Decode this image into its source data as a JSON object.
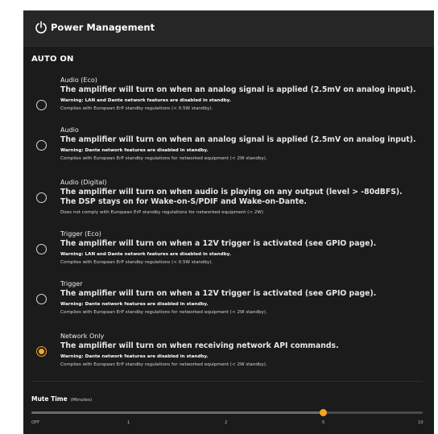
{
  "header": {
    "title": "Power Management",
    "icon": "power-icon"
  },
  "section": {
    "label": "AUTO ON"
  },
  "accent_color": "#f5a623",
  "options": [
    {
      "title": "Audio (Eco)",
      "description": "The amplifier will turn on when an analog signal is applied (2.5mV on analog input).",
      "description2": "",
      "warning": "Warning: LAN and Dante network features are disabled in standby.",
      "note": "Complies with European ErP standby regulations (< 0.5W standby).",
      "selected": false
    },
    {
      "title": "Audio",
      "description": "The amplifier will turn on when an analog signal is applied (2.5mV on analog input).",
      "description2": "",
      "warning": "Warning: Dante network features are disabled in standby.",
      "note": "Complies with European ErP standby regulations for networked equipment (< 2W standby).",
      "selected": false
    },
    {
      "title": "Audio (Digital)",
      "description": "The amplifier will turn on when audio is playing on any output (level > -80dBFS).",
      "description2": "The DSP stays on for Wake-on-S/PDIF and Wake-on-Dante.",
      "warning": "",
      "note": "Does not comply with European ErP standby regulations for networked equipment (< 2W)",
      "selected": false
    },
    {
      "title": "Trigger (Eco)",
      "description": "The amplifier will turn on when a 12V trigger is activated (see GPIO page).",
      "description2": "",
      "warning": "Warning: LAN and Dante network features are disabled in standby.",
      "note": "Complies with European ErP standby regulations (< 0.5W standby).",
      "selected": false
    },
    {
      "title": "Trigger",
      "description": "The amplifier will turn on when a 12V trigger is activated (see GPIO page).",
      "description2": "",
      "warning": "Warning: Dante network features are disabled in standby.",
      "note": "Complies with European ErP standby regulations for networked equipment (< 2W standby).",
      "selected": false
    },
    {
      "title": "Network Only",
      "description": "The amplifier will turn on when receiving network API commands.",
      "description2": "",
      "warning": "Warning: Dante network features are disabled in standby.",
      "note": "Complies with European ErP standby regulations for networked equipment (< 2W standby).",
      "selected": true
    }
  ],
  "mute_time": {
    "label": "Mute Time",
    "unit": "(Minutes)",
    "value": "5",
    "ticks": [
      "OFF",
      "1",
      "2",
      "5",
      "10"
    ]
  }
}
